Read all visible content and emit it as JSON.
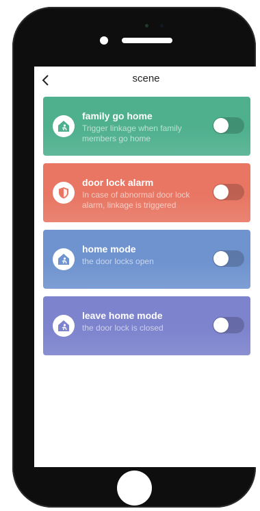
{
  "header": {
    "title": "scene",
    "back_icon": "chevron-left-icon"
  },
  "scenes": [
    {
      "title": "family go home",
      "description": "Trigger linkage when family members go home",
      "color": "#4fb08e",
      "icon": "home-person-icon",
      "enabled": false
    },
    {
      "title": "door lock alarm",
      "description": "In case of abnormal door lock alarm, linkage is triggered",
      "color": "#e87663",
      "icon": "shield-icon",
      "enabled": false
    },
    {
      "title": "home mode",
      "description": "the door locks open",
      "color": "#6f93cf",
      "icon": "home-person-icon",
      "enabled": false
    },
    {
      "title": "leave home mode",
      "description": "the door lock is closed",
      "color": "#7d83cd",
      "icon": "home-person-icon",
      "enabled": false
    }
  ]
}
